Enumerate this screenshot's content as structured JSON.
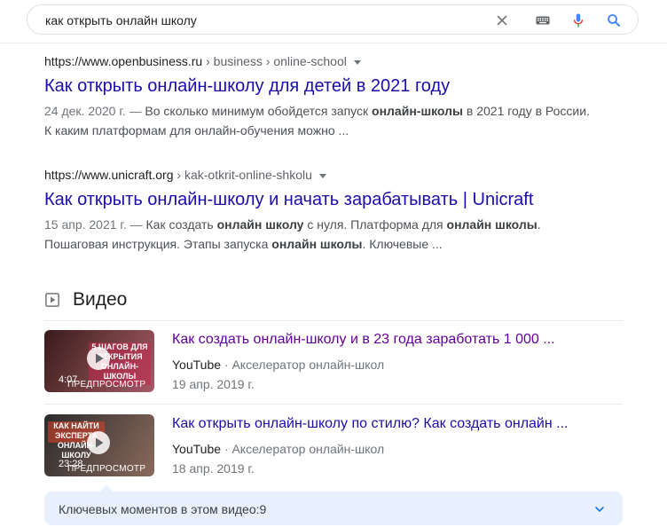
{
  "search": {
    "query": "как открыть онлайн школу",
    "colors": {
      "google_blue": "#4285f4",
      "mic_red": "#ea4335",
      "mic_yellow": "#fbbc05",
      "mic_green": "#34a853"
    }
  },
  "results": [
    {
      "domain": "https://www.openbusiness.ru",
      "path": " › business › online-school",
      "title": "Как открыть онлайн-школу для детей в 2021 году",
      "snippet_date": "24 дек. 2020 г. — ",
      "snippet_parts": [
        "Во сколько минимум обойдется запуск ",
        "онлайн-школы",
        " в 2021 году в России. К каким платформам для онлайн-обучения можно ..."
      ]
    },
    {
      "domain": "https://www.unicraft.org",
      "path": " › kak-otkrit-online-shkolu",
      "title": "Как открыть онлайн-школу и начать зарабатывать | Unicraft",
      "snippet_date": "15 апр. 2021 г. — ",
      "snippet_parts": [
        "Как создать ",
        "онлайн школу",
        " с нуля. Платформа для ",
        "онлайн школы",
        ". Пошаговая инструкция. Этапы запуска ",
        "онлайн школы",
        ". Ключевые ..."
      ]
    }
  ],
  "videos": {
    "heading": "Видео",
    "items": [
      {
        "title": "Как создать онлайн-школу и в 23 года заработать 1 000 ...",
        "platform": "YouTube",
        "separator": " · ",
        "channel": "Акселератор онлайн-школ",
        "date": "19 апр. 2019 г.",
        "duration": "4:07",
        "preview_label": "ПРЕДПРОСМОТР",
        "thumb_text": "5 ШАГОВ ДЛЯ ОТКРЫТИЯ ОНЛАЙН-ШКОЛЫ"
      },
      {
        "title": "Как открыть онлайн-школу по стилю? Как создать онлайн ...",
        "platform": "YouTube",
        "separator": " · ",
        "channel": "Акселератор онлайн-школ",
        "date": "18 апр. 2019 г.",
        "duration": "23:28",
        "preview_label": "ПРЕДПРОСМОТР",
        "thumb_text": "КАК НАЙТИ ЭКСПЕРТА ОНЛАЙН-ШКОЛУ"
      }
    ],
    "key_moments_label": "Ключевых моментов в этом видео:",
    "key_moments_count": "9"
  }
}
